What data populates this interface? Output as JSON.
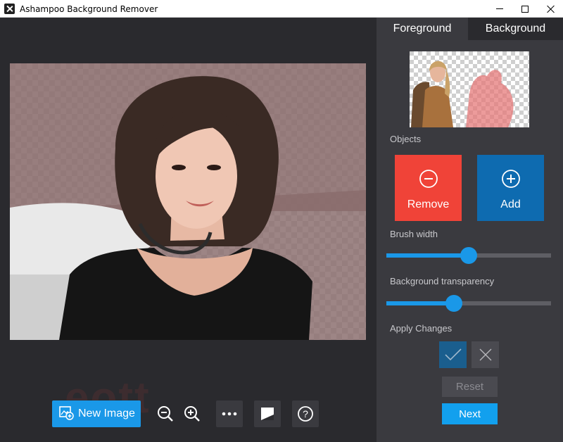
{
  "window": {
    "title": "Ashampoo Background Remover"
  },
  "panel": {
    "tabs": [
      {
        "label": "Foreground",
        "active": true
      },
      {
        "label": "Background",
        "active": false
      }
    ],
    "objects_label": "Objects",
    "remove_label": "Remove",
    "add_label": "Add",
    "brush_width_label": "Brush width",
    "brush_width_value": 0.5,
    "transparency_label": "Background transparency",
    "transparency_value": 0.41,
    "apply_label": "Apply Changes",
    "reset_label": "Reset",
    "next_label": "Next"
  },
  "toolbar": {
    "new_image_label": "New Image",
    "tools": [
      "zoom-out-icon",
      "zoom-in-icon",
      "more-icon",
      "compare-icon",
      "help-icon"
    ]
  },
  "watermark": "eott",
  "colors": {
    "accent": "#1a98e8",
    "remove": "#f04338",
    "add": "#0e6bb0",
    "panel": "#3a3a3f",
    "workspace": "#2a2a2e"
  }
}
